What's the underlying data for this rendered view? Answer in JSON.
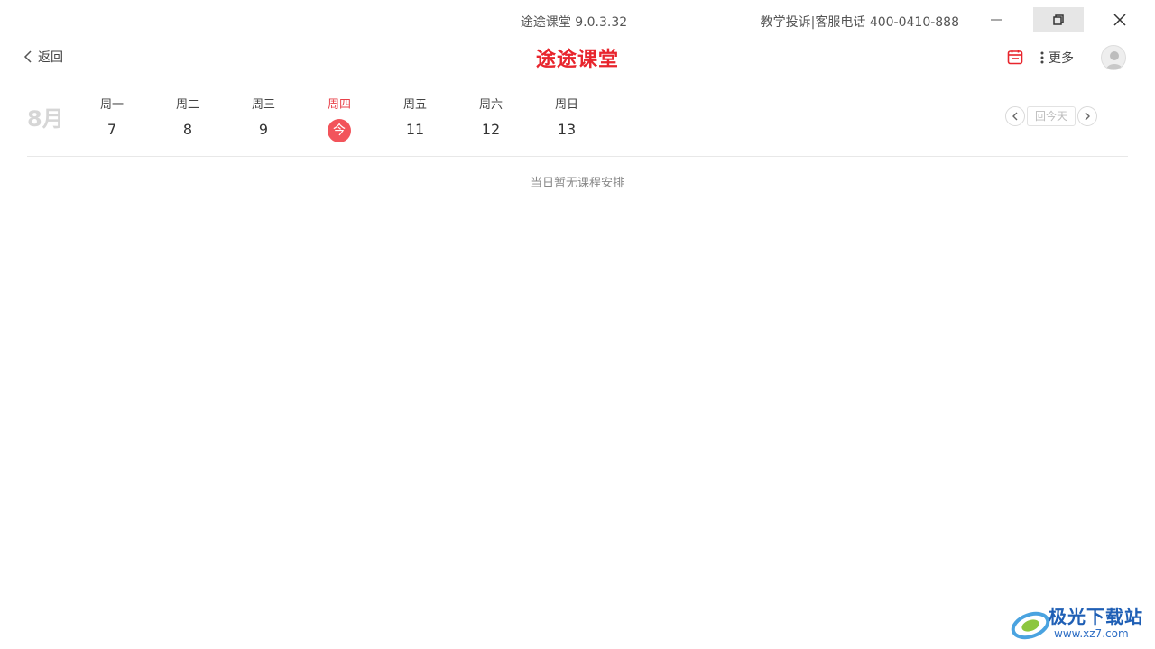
{
  "window": {
    "title": "途途课堂 9.0.3.32",
    "support_text": "教学投诉|客服电话 400-0410-888"
  },
  "header": {
    "back_label": "返回",
    "logo_text": "途途课堂",
    "more_label": "更多"
  },
  "week": {
    "month": "8月",
    "days": [
      {
        "weekday": "周一",
        "date": "7"
      },
      {
        "weekday": "周二",
        "date": "8"
      },
      {
        "weekday": "周三",
        "date": "9"
      },
      {
        "weekday": "周四",
        "date": "今"
      },
      {
        "weekday": "周五",
        "date": "11"
      },
      {
        "weekday": "周六",
        "date": "12"
      },
      {
        "weekday": "周日",
        "date": "13"
      }
    ],
    "today_button": "回今天"
  },
  "content": {
    "empty_text": "当日暂无课程安排"
  },
  "watermark": {
    "name": "极光下载站",
    "url": "www.xz7.com"
  },
  "colors": {
    "accent": "#e8252d",
    "today_circle": "#f2545b"
  }
}
